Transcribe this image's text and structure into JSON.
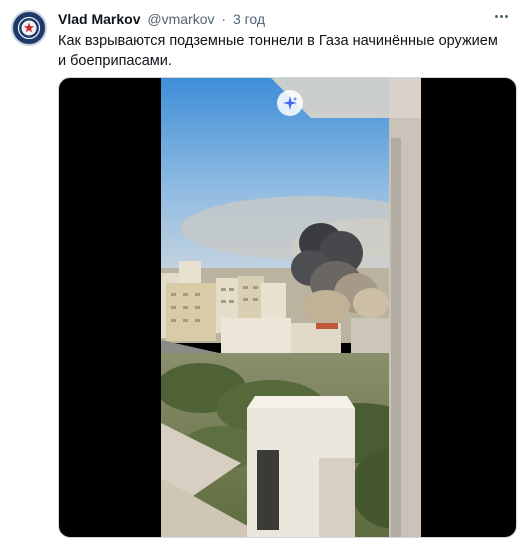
{
  "tweet": {
    "author_name": "Vlad Markov",
    "author_handle": "@vmarkov",
    "separator": "·",
    "time": "3 год",
    "text": "Как взрываются подземные тоннели в Газа начинённые оружием и боеприпасами."
  },
  "icons": {
    "avatar": "cia-seal-avatar",
    "more": "more-options-icon",
    "sparkle": "sparkle-icon"
  },
  "colors": {
    "text": "#0f1419",
    "secondary": "#536471",
    "sparkle": "#3f63f5"
  }
}
